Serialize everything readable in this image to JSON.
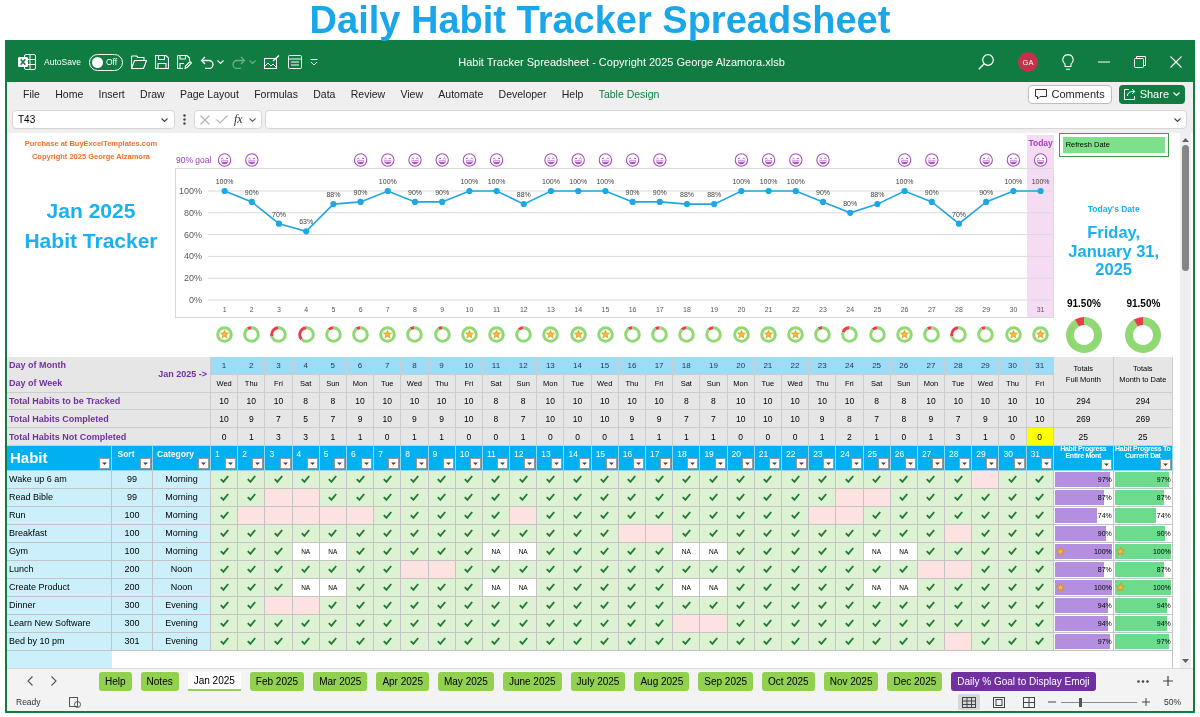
{
  "page_title": "Daily Habit Tracker Spreadsheet",
  "window": {
    "title": "Habit Tracker Spreadsheet - Copyright 2025 George Alzamora.xlsb",
    "autosave": {
      "label": "AutoSave",
      "on": false,
      "state_label": "Off"
    },
    "redo": {
      "disabled": true
    },
    "user_initials": "GA"
  },
  "menu": {
    "items": [
      {
        "label": "File",
        "kind": "tab"
      },
      {
        "label": "Home",
        "kind": "tab"
      },
      {
        "label": "Insert",
        "kind": "tab"
      },
      {
        "label": "Draw",
        "kind": "tab"
      },
      {
        "label": "Page Layout",
        "kind": "tab"
      },
      {
        "label": "Formulas",
        "kind": "tab"
      },
      {
        "label": "Data",
        "kind": "tab"
      },
      {
        "label": "Review",
        "kind": "tab"
      },
      {
        "label": "View",
        "kind": "tab"
      },
      {
        "label": "Automate",
        "kind": "tab"
      },
      {
        "label": "Developer",
        "kind": "tab"
      },
      {
        "label": "Help",
        "kind": "tab"
      },
      {
        "label": "Table Design",
        "kind": "contextual"
      }
    ],
    "comments_button": "Comments",
    "share_button": "Share"
  },
  "formula_bar": {
    "name_box": "T43",
    "edit_buttons": {
      "disabled": true
    },
    "function_label": "fx"
  },
  "sheet": {
    "purchase_note": "Purchase at BuyExcelTemplates.com",
    "copyright": "Copyright 2025 George Alzamora",
    "heading": "Jan 2025\nHabit Tracker",
    "goal_label": "90% goal",
    "goal_emojis": [
      {
        "shown": true
      },
      {
        "shown": true
      },
      {
        "shown": false
      },
      {
        "shown": false
      },
      {
        "shown": false
      },
      {
        "shown": true
      },
      {
        "shown": true
      },
      {
        "shown": true
      },
      {
        "shown": true
      },
      {
        "shown": true
      },
      {
        "shown": true
      },
      {
        "shown": false
      },
      {
        "shown": true
      },
      {
        "shown": true
      },
      {
        "shown": true
      },
      {
        "shown": true
      },
      {
        "shown": true
      },
      {
        "shown": false
      },
      {
        "shown": false
      },
      {
        "shown": true
      },
      {
        "shown": true
      },
      {
        "shown": true
      },
      {
        "shown": true
      },
      {
        "shown": false
      },
      {
        "shown": false
      },
      {
        "shown": true
      },
      {
        "shown": true
      },
      {
        "shown": false
      },
      {
        "shown": true
      },
      {
        "shown": true
      },
      {
        "shown": true
      }
    ],
    "chart_data": [
      {
        "type": "line",
        "x": [
          1,
          2,
          3,
          4,
          5,
          6,
          7,
          8,
          9,
          10,
          11,
          12,
          13,
          14,
          15,
          16,
          17,
          18,
          19,
          20,
          21,
          22,
          23,
          24,
          25,
          26,
          27,
          28,
          29,
          30,
          31
        ],
        "xticks": [
          1,
          2,
          3,
          4,
          5,
          6,
          7,
          8,
          9,
          10,
          11,
          12,
          13,
          14,
          15,
          16,
          17,
          18,
          19,
          20,
          21,
          22,
          23,
          24,
          25,
          26,
          27,
          28,
          29,
          30,
          31
        ],
        "xlim": [
          0.5,
          31.5
        ],
        "values": [
          100,
          90,
          70,
          63,
          88,
          90,
          100,
          90,
          90,
          100,
          100,
          88,
          100,
          100,
          100,
          90,
          90,
          88,
          88,
          100,
          100,
          100,
          90,
          80,
          88,
          100,
          90,
          70,
          90,
          100,
          100
        ],
        "value_labels": [
          "100%",
          "90%",
          "70%",
          "63%",
          "88%",
          "90%",
          "100%",
          "90%",
          "90%",
          "100%",
          "100%",
          "88%",
          "100%",
          "100%",
          "100%",
          "90%",
          "90%",
          "88%",
          "88%",
          "100%",
          "100%",
          "100%",
          "90%",
          "80%",
          "88%",
          "100%",
          "90%",
          "70%",
          "90%",
          "100%",
          "100%"
        ],
        "ylim": [
          0,
          100
        ],
        "yticks": [
          {
            "value": 0,
            "label": "0%"
          },
          {
            "value": 20,
            "label": "20%"
          },
          {
            "value": 40,
            "label": "40%"
          },
          {
            "value": 60,
            "label": "60%"
          },
          {
            "value": 80,
            "label": "80%"
          },
          {
            "value": 100,
            "label": "100%"
          }
        ],
        "color": "#1fa6e3",
        "marker": "circle",
        "grid": "y",
        "bands": [
          {
            "axis": "x",
            "from": 30.5,
            "to": 31.5,
            "label": "Today",
            "color": "#f5dcf2"
          }
        ]
      }
    ],
    "today_panel": {
      "refresh_button": "Refresh Date",
      "label": "Today's Date",
      "date": "Friday,\nJanuary 31,\n2025",
      "totals": [
        {
          "reading": "91.50%",
          "chart_data": [
            {
              "type": "donut",
              "values": [
                91.5,
                8.5
              ],
              "colors": [
                "#8fd873",
                "#ee3b47"
              ]
            }
          ]
        },
        {
          "reading": "91.50%",
          "chart_data": [
            {
              "type": "donut",
              "values": [
                91.5,
                8.5
              ],
              "colors": [
                "#8fd873",
                "#ee3b47"
              ]
            }
          ]
        }
      ]
    }
  },
  "summary": {
    "month_label": "Jan 2025 ->",
    "totals_headers": [
      "Totals\nFull Month",
      "Totals\nMonth to Date"
    ],
    "rows": [
      {
        "kind": "day",
        "label": "Day of Month",
        "cells": [
          "1",
          "2",
          "3",
          "4",
          "5",
          "6",
          "7",
          "8",
          "9",
          "10",
          "11",
          "12",
          "13",
          "14",
          "15",
          "16",
          "17",
          "18",
          "19",
          "20",
          "21",
          "22",
          "23",
          "24",
          "25",
          "26",
          "27",
          "28",
          "29",
          "30",
          "31"
        ]
      },
      {
        "kind": "weekday",
        "label": "Day of Week",
        "cells": [
          "Wed",
          "Thu",
          "Fri",
          "Sat",
          "Sun",
          "Mon",
          "Tue",
          "Wed",
          "Thu",
          "Fri",
          "Sat",
          "Sun",
          "Mon",
          "Tue",
          "Wed",
          "Thu",
          "Fri",
          "Sat",
          "Sun",
          "Mon",
          "Tue",
          "Wed",
          "Thu",
          "Fri",
          "Sat",
          "Sun",
          "Mon",
          "Tue",
          "Wed",
          "Thu",
          "Fri"
        ]
      },
      {
        "kind": "tracked",
        "label": "Total Habits to be Tracked",
        "cells": [
          "10",
          "10",
          "10",
          "8",
          "8",
          "10",
          "10",
          "10",
          "10",
          "10",
          "8",
          "8",
          "10",
          "10",
          "10",
          "10",
          "10",
          "8",
          "8",
          "10",
          "10",
          "10",
          "10",
          "10",
          "8",
          "8",
          "10",
          "10",
          "10",
          "10",
          "10"
        ],
        "totals": [
          "294",
          "294"
        ]
      },
      {
        "kind": "completed",
        "label": "Total Habits Completed",
        "cells": [
          "10",
          "9",
          "7",
          "5",
          "7",
          "9",
          "10",
          "9",
          "9",
          "10",
          "8",
          "7",
          "10",
          "10",
          "10",
          "9",
          "9",
          "7",
          "7",
          "10",
          "10",
          "10",
          "9",
          "8",
          "7",
          "8",
          "9",
          "7",
          "9",
          "10",
          "10"
        ],
        "totals": [
          "269",
          "269"
        ]
      },
      {
        "kind": "flagged_count",
        "label": "Total Habits Not Completed",
        "cells": [
          {
            "text": "0",
            "highlighted": false
          },
          {
            "text": "1",
            "highlighted": false
          },
          {
            "text": "3",
            "highlighted": false
          },
          {
            "text": "3",
            "highlighted": false
          },
          {
            "text": "1",
            "highlighted": false
          },
          {
            "text": "1",
            "highlighted": false
          },
          {
            "text": "0",
            "highlighted": false
          },
          {
            "text": "1",
            "highlighted": false
          },
          {
            "text": "1",
            "highlighted": false
          },
          {
            "text": "0",
            "highlighted": false
          },
          {
            "text": "0",
            "highlighted": false
          },
          {
            "text": "1",
            "highlighted": false
          },
          {
            "text": "0",
            "highlighted": false
          },
          {
            "text": "0",
            "highlighted": false
          },
          {
            "text": "0",
            "highlighted": false
          },
          {
            "text": "1",
            "highlighted": false
          },
          {
            "text": "1",
            "highlighted": false
          },
          {
            "text": "1",
            "highlighted": false
          },
          {
            "text": "1",
            "highlighted": false
          },
          {
            "text": "0",
            "highlighted": false
          },
          {
            "text": "0",
            "highlighted": false
          },
          {
            "text": "0",
            "highlighted": false
          },
          {
            "text": "1",
            "highlighted": false
          },
          {
            "text": "2",
            "highlighted": false
          },
          {
            "text": "1",
            "highlighted": false
          },
          {
            "text": "0",
            "highlighted": false
          },
          {
            "text": "1",
            "highlighted": false
          },
          {
            "text": "3",
            "highlighted": false
          },
          {
            "text": "1",
            "highlighted": false
          },
          {
            "text": "0",
            "highlighted": false
          },
          {
            "text": "0",
            "highlighted": true
          }
        ],
        "totals": [
          "25",
          "25"
        ]
      }
    ]
  },
  "habits": {
    "columns": [
      "Habit",
      "Sort",
      "Category",
      "1",
      "2",
      "3",
      "4",
      "5",
      "6",
      "7",
      "8",
      "9",
      "10",
      "11",
      "12",
      "13",
      "14",
      "15",
      "16",
      "17",
      "18",
      "19",
      "20",
      "21",
      "22",
      "23",
      "24",
      "25",
      "26",
      "27",
      "28",
      "29",
      "30",
      "31",
      "Habit Progress\nEntire Mont",
      "Habit Progress To\nCurrent Dat"
    ],
    "rows": [
      {
        "name": "Wake up 6 am",
        "sort": "99",
        "category": "Morning",
        "days": [
          {
            "kind": "done"
          },
          {
            "kind": "done"
          },
          {
            "kind": "done"
          },
          {
            "kind": "done"
          },
          {
            "kind": "done"
          },
          {
            "kind": "done"
          },
          {
            "kind": "done"
          },
          {
            "kind": "done"
          },
          {
            "kind": "done"
          },
          {
            "kind": "done"
          },
          {
            "kind": "done"
          },
          {
            "kind": "done"
          },
          {
            "kind": "done"
          },
          {
            "kind": "done"
          },
          {
            "kind": "done"
          },
          {
            "kind": "done"
          },
          {
            "kind": "done"
          },
          {
            "kind": "done"
          },
          {
            "kind": "done"
          },
          {
            "kind": "done"
          },
          {
            "kind": "done"
          },
          {
            "kind": "done"
          },
          {
            "kind": "done"
          },
          {
            "kind": "done"
          },
          {
            "kind": "done"
          },
          {
            "kind": "done"
          },
          {
            "kind": "done"
          },
          {
            "kind": "done"
          },
          {
            "kind": "missed"
          },
          {
            "kind": "done"
          },
          {
            "kind": "done"
          }
        ],
        "progress": [
          {
            "level": 0.97,
            "reading": "97%",
            "star": false
          },
          {
            "level": 0.97,
            "reading": "97%",
            "star": false
          }
        ]
      },
      {
        "name": "Read Bible",
        "sort": "99",
        "category": "Morning",
        "days": [
          {
            "kind": "done"
          },
          {
            "kind": "done"
          },
          {
            "kind": "missed"
          },
          {
            "kind": "missed"
          },
          {
            "kind": "done"
          },
          {
            "kind": "done"
          },
          {
            "kind": "done"
          },
          {
            "kind": "done"
          },
          {
            "kind": "done"
          },
          {
            "kind": "done"
          },
          {
            "kind": "done"
          },
          {
            "kind": "done"
          },
          {
            "kind": "done"
          },
          {
            "kind": "done"
          },
          {
            "kind": "done"
          },
          {
            "kind": "done"
          },
          {
            "kind": "done"
          },
          {
            "kind": "done"
          },
          {
            "kind": "done"
          },
          {
            "kind": "done"
          },
          {
            "kind": "done"
          },
          {
            "kind": "done"
          },
          {
            "kind": "done"
          },
          {
            "kind": "missed"
          },
          {
            "kind": "missed"
          },
          {
            "kind": "done"
          },
          {
            "kind": "done"
          },
          {
            "kind": "done"
          },
          {
            "kind": "done"
          },
          {
            "kind": "done"
          },
          {
            "kind": "done"
          }
        ],
        "progress": [
          {
            "level": 0.87,
            "reading": "87%",
            "star": false
          },
          {
            "level": 0.87,
            "reading": "87%",
            "star": false
          }
        ]
      },
      {
        "name": "Run",
        "sort": "100",
        "category": "Morning",
        "days": [
          {
            "kind": "done"
          },
          {
            "kind": "missed"
          },
          {
            "kind": "missed"
          },
          {
            "kind": "missed"
          },
          {
            "kind": "missed"
          },
          {
            "kind": "missed"
          },
          {
            "kind": "done"
          },
          {
            "kind": "done"
          },
          {
            "kind": "done"
          },
          {
            "kind": "done"
          },
          {
            "kind": "done"
          },
          {
            "kind": "missed"
          },
          {
            "kind": "done"
          },
          {
            "kind": "done"
          },
          {
            "kind": "done"
          },
          {
            "kind": "done"
          },
          {
            "kind": "done"
          },
          {
            "kind": "done"
          },
          {
            "kind": "done"
          },
          {
            "kind": "done"
          },
          {
            "kind": "done"
          },
          {
            "kind": "done"
          },
          {
            "kind": "missed"
          },
          {
            "kind": "missed"
          },
          {
            "kind": "done"
          },
          {
            "kind": "done"
          },
          {
            "kind": "done"
          },
          {
            "kind": "done"
          },
          {
            "kind": "done"
          },
          {
            "kind": "done"
          },
          {
            "kind": "done"
          }
        ],
        "progress": [
          {
            "level": 0.74,
            "reading": "74%",
            "star": false
          },
          {
            "level": 0.74,
            "reading": "74%",
            "star": false
          }
        ]
      },
      {
        "name": "Breakfast",
        "sort": "100",
        "category": "Morning",
        "days": [
          {
            "kind": "done"
          },
          {
            "kind": "done"
          },
          {
            "kind": "done"
          },
          {
            "kind": "done"
          },
          {
            "kind": "done"
          },
          {
            "kind": "done"
          },
          {
            "kind": "done"
          },
          {
            "kind": "done"
          },
          {
            "kind": "done"
          },
          {
            "kind": "done"
          },
          {
            "kind": "done"
          },
          {
            "kind": "done"
          },
          {
            "kind": "done"
          },
          {
            "kind": "done"
          },
          {
            "kind": "done"
          },
          {
            "kind": "missed"
          },
          {
            "kind": "missed"
          },
          {
            "kind": "done"
          },
          {
            "kind": "done"
          },
          {
            "kind": "done"
          },
          {
            "kind": "done"
          },
          {
            "kind": "done"
          },
          {
            "kind": "done"
          },
          {
            "kind": "done"
          },
          {
            "kind": "done"
          },
          {
            "kind": "done"
          },
          {
            "kind": "done"
          },
          {
            "kind": "missed"
          },
          {
            "kind": "done"
          },
          {
            "kind": "done"
          },
          {
            "kind": "done"
          }
        ],
        "progress": [
          {
            "level": 0.9,
            "reading": "90%",
            "star": false
          },
          {
            "level": 0.9,
            "reading": "90%",
            "star": false
          }
        ]
      },
      {
        "name": "Gym",
        "sort": "100",
        "category": "Morning",
        "days": [
          {
            "kind": "done"
          },
          {
            "kind": "done"
          },
          {
            "kind": "done"
          },
          {
            "kind": "na",
            "text": "NA"
          },
          {
            "kind": "na",
            "text": "NA"
          },
          {
            "kind": "done"
          },
          {
            "kind": "done"
          },
          {
            "kind": "done"
          },
          {
            "kind": "done"
          },
          {
            "kind": "done"
          },
          {
            "kind": "na",
            "text": "NA"
          },
          {
            "kind": "na",
            "text": "NA"
          },
          {
            "kind": "done"
          },
          {
            "kind": "done"
          },
          {
            "kind": "done"
          },
          {
            "kind": "done"
          },
          {
            "kind": "done"
          },
          {
            "kind": "na",
            "text": "NA"
          },
          {
            "kind": "na",
            "text": "NA"
          },
          {
            "kind": "done"
          },
          {
            "kind": "done"
          },
          {
            "kind": "done"
          },
          {
            "kind": "done"
          },
          {
            "kind": "done"
          },
          {
            "kind": "na",
            "text": "NA"
          },
          {
            "kind": "na",
            "text": "NA"
          },
          {
            "kind": "done"
          },
          {
            "kind": "done"
          },
          {
            "kind": "done"
          },
          {
            "kind": "done"
          },
          {
            "kind": "done"
          }
        ],
        "progress": [
          {
            "level": 1,
            "reading": "100%",
            "star": true
          },
          {
            "level": 1,
            "reading": "100%",
            "star": true
          }
        ]
      },
      {
        "name": "Lunch",
        "sort": "200",
        "category": "Noon",
        "days": [
          {
            "kind": "done"
          },
          {
            "kind": "done"
          },
          {
            "kind": "done"
          },
          {
            "kind": "done"
          },
          {
            "kind": "done"
          },
          {
            "kind": "done"
          },
          {
            "kind": "done"
          },
          {
            "kind": "missed"
          },
          {
            "kind": "missed"
          },
          {
            "kind": "done"
          },
          {
            "kind": "done"
          },
          {
            "kind": "done"
          },
          {
            "kind": "done"
          },
          {
            "kind": "done"
          },
          {
            "kind": "done"
          },
          {
            "kind": "done"
          },
          {
            "kind": "done"
          },
          {
            "kind": "done"
          },
          {
            "kind": "done"
          },
          {
            "kind": "done"
          },
          {
            "kind": "done"
          },
          {
            "kind": "done"
          },
          {
            "kind": "done"
          },
          {
            "kind": "done"
          },
          {
            "kind": "done"
          },
          {
            "kind": "done"
          },
          {
            "kind": "missed"
          },
          {
            "kind": "missed"
          },
          {
            "kind": "done"
          },
          {
            "kind": "done"
          },
          {
            "kind": "done"
          }
        ],
        "progress": [
          {
            "level": 0.87,
            "reading": "87%",
            "star": false
          },
          {
            "level": 0.87,
            "reading": "87%",
            "star": false
          }
        ]
      },
      {
        "name": "Create Product",
        "sort": "200",
        "category": "Noon",
        "days": [
          {
            "kind": "done"
          },
          {
            "kind": "done"
          },
          {
            "kind": "done"
          },
          {
            "kind": "na",
            "text": "NA"
          },
          {
            "kind": "na",
            "text": "NA"
          },
          {
            "kind": "done"
          },
          {
            "kind": "done"
          },
          {
            "kind": "done"
          },
          {
            "kind": "done"
          },
          {
            "kind": "done"
          },
          {
            "kind": "na",
            "text": "NA"
          },
          {
            "kind": "na",
            "text": "NA"
          },
          {
            "kind": "done"
          },
          {
            "kind": "done"
          },
          {
            "kind": "done"
          },
          {
            "kind": "done"
          },
          {
            "kind": "done"
          },
          {
            "kind": "na",
            "text": "NA"
          },
          {
            "kind": "na",
            "text": "NA"
          },
          {
            "kind": "done"
          },
          {
            "kind": "done"
          },
          {
            "kind": "done"
          },
          {
            "kind": "done"
          },
          {
            "kind": "done"
          },
          {
            "kind": "na",
            "text": "NA"
          },
          {
            "kind": "na",
            "text": "NA"
          },
          {
            "kind": "done"
          },
          {
            "kind": "done"
          },
          {
            "kind": "done"
          },
          {
            "kind": "done"
          },
          {
            "kind": "done"
          }
        ],
        "progress": [
          {
            "level": 1,
            "reading": "100%",
            "star": true
          },
          {
            "level": 1,
            "reading": "100%",
            "star": true
          }
        ]
      },
      {
        "name": "Dinner",
        "sort": "300",
        "category": "Evening",
        "days": [
          {
            "kind": "done"
          },
          {
            "kind": "done"
          },
          {
            "kind": "missed"
          },
          {
            "kind": "missed"
          },
          {
            "kind": "done"
          },
          {
            "kind": "done"
          },
          {
            "kind": "done"
          },
          {
            "kind": "done"
          },
          {
            "kind": "done"
          },
          {
            "kind": "done"
          },
          {
            "kind": "done"
          },
          {
            "kind": "done"
          },
          {
            "kind": "done"
          },
          {
            "kind": "done"
          },
          {
            "kind": "done"
          },
          {
            "kind": "done"
          },
          {
            "kind": "done"
          },
          {
            "kind": "done"
          },
          {
            "kind": "done"
          },
          {
            "kind": "done"
          },
          {
            "kind": "done"
          },
          {
            "kind": "done"
          },
          {
            "kind": "done"
          },
          {
            "kind": "done"
          },
          {
            "kind": "done"
          },
          {
            "kind": "done"
          },
          {
            "kind": "done"
          },
          {
            "kind": "done"
          },
          {
            "kind": "done"
          },
          {
            "kind": "done"
          },
          {
            "kind": "done"
          }
        ],
        "progress": [
          {
            "level": 0.94,
            "reading": "94%",
            "star": false
          },
          {
            "level": 0.94,
            "reading": "94%",
            "star": false
          }
        ]
      },
      {
        "name": "Learn New Software",
        "sort": "300",
        "category": "Evening",
        "days": [
          {
            "kind": "done"
          },
          {
            "kind": "done"
          },
          {
            "kind": "done"
          },
          {
            "kind": "done"
          },
          {
            "kind": "done"
          },
          {
            "kind": "done"
          },
          {
            "kind": "done"
          },
          {
            "kind": "done"
          },
          {
            "kind": "done"
          },
          {
            "kind": "done"
          },
          {
            "kind": "done"
          },
          {
            "kind": "done"
          },
          {
            "kind": "done"
          },
          {
            "kind": "done"
          },
          {
            "kind": "done"
          },
          {
            "kind": "done"
          },
          {
            "kind": "done"
          },
          {
            "kind": "missed"
          },
          {
            "kind": "missed"
          },
          {
            "kind": "done"
          },
          {
            "kind": "done"
          },
          {
            "kind": "done"
          },
          {
            "kind": "done"
          },
          {
            "kind": "done"
          },
          {
            "kind": "done"
          },
          {
            "kind": "done"
          },
          {
            "kind": "done"
          },
          {
            "kind": "done"
          },
          {
            "kind": "done"
          },
          {
            "kind": "done"
          },
          {
            "kind": "done"
          }
        ],
        "progress": [
          {
            "level": 0.94,
            "reading": "94%",
            "star": false
          },
          {
            "level": 0.94,
            "reading": "94%",
            "star": false
          }
        ]
      },
      {
        "name": "Bed by 10 pm",
        "sort": "301",
        "category": "Evening",
        "days": [
          {
            "kind": "done"
          },
          {
            "kind": "done"
          },
          {
            "kind": "done"
          },
          {
            "kind": "done"
          },
          {
            "kind": "done"
          },
          {
            "kind": "done"
          },
          {
            "kind": "done"
          },
          {
            "kind": "done"
          },
          {
            "kind": "done"
          },
          {
            "kind": "done"
          },
          {
            "kind": "done"
          },
          {
            "kind": "done"
          },
          {
            "kind": "done"
          },
          {
            "kind": "done"
          },
          {
            "kind": "done"
          },
          {
            "kind": "done"
          },
          {
            "kind": "done"
          },
          {
            "kind": "done"
          },
          {
            "kind": "done"
          },
          {
            "kind": "done"
          },
          {
            "kind": "done"
          },
          {
            "kind": "done"
          },
          {
            "kind": "done"
          },
          {
            "kind": "done"
          },
          {
            "kind": "done"
          },
          {
            "kind": "done"
          },
          {
            "kind": "done"
          },
          {
            "kind": "missed"
          },
          {
            "kind": "done"
          },
          {
            "kind": "done"
          },
          {
            "kind": "done"
          }
        ],
        "progress": [
          {
            "level": 0.97,
            "reading": "97%",
            "star": false
          },
          {
            "level": 0.97,
            "reading": "97%",
            "star": false
          }
        ]
      }
    ]
  },
  "sheet_tabs": [
    {
      "label": "Help",
      "selected": false,
      "color": "#92d050"
    },
    {
      "label": "Notes",
      "selected": false,
      "color": "#92d050"
    },
    {
      "label": "Jan 2025",
      "selected": true,
      "color": "#92d050"
    },
    {
      "label": "Feb 2025",
      "selected": false,
      "color": "#92d050"
    },
    {
      "label": "Mar 2025",
      "selected": false,
      "color": "#92d050"
    },
    {
      "label": "Apr 2025",
      "selected": false,
      "color": "#92d050"
    },
    {
      "label": "May 2025",
      "selected": false,
      "color": "#92d050"
    },
    {
      "label": "June 2025",
      "selected": false,
      "color": "#92d050"
    },
    {
      "label": "July 2025",
      "selected": false,
      "color": "#92d050"
    },
    {
      "label": "Aug 2025",
      "selected": false,
      "color": "#92d050"
    },
    {
      "label": "Sep 2025",
      "selected": false,
      "color": "#92d050"
    },
    {
      "label": "Oct 2025",
      "selected": false,
      "color": "#92d050"
    },
    {
      "label": "Nov 2025",
      "selected": false,
      "color": "#92d050"
    },
    {
      "label": "Dec 2025",
      "selected": false,
      "color": "#92d050"
    },
    {
      "label": "Daily % Goal to Display Emoji",
      "selected": false,
      "color": "#7030a0"
    }
  ],
  "status_bar": {
    "status": "Ready",
    "views": [
      {
        "kind": "normal",
        "selected": true
      },
      {
        "kind": "page_layout",
        "selected": false
      },
      {
        "kind": "page_break",
        "selected": false
      }
    ],
    "zoom": {
      "level": 0.25,
      "reading": "50%"
    }
  }
}
